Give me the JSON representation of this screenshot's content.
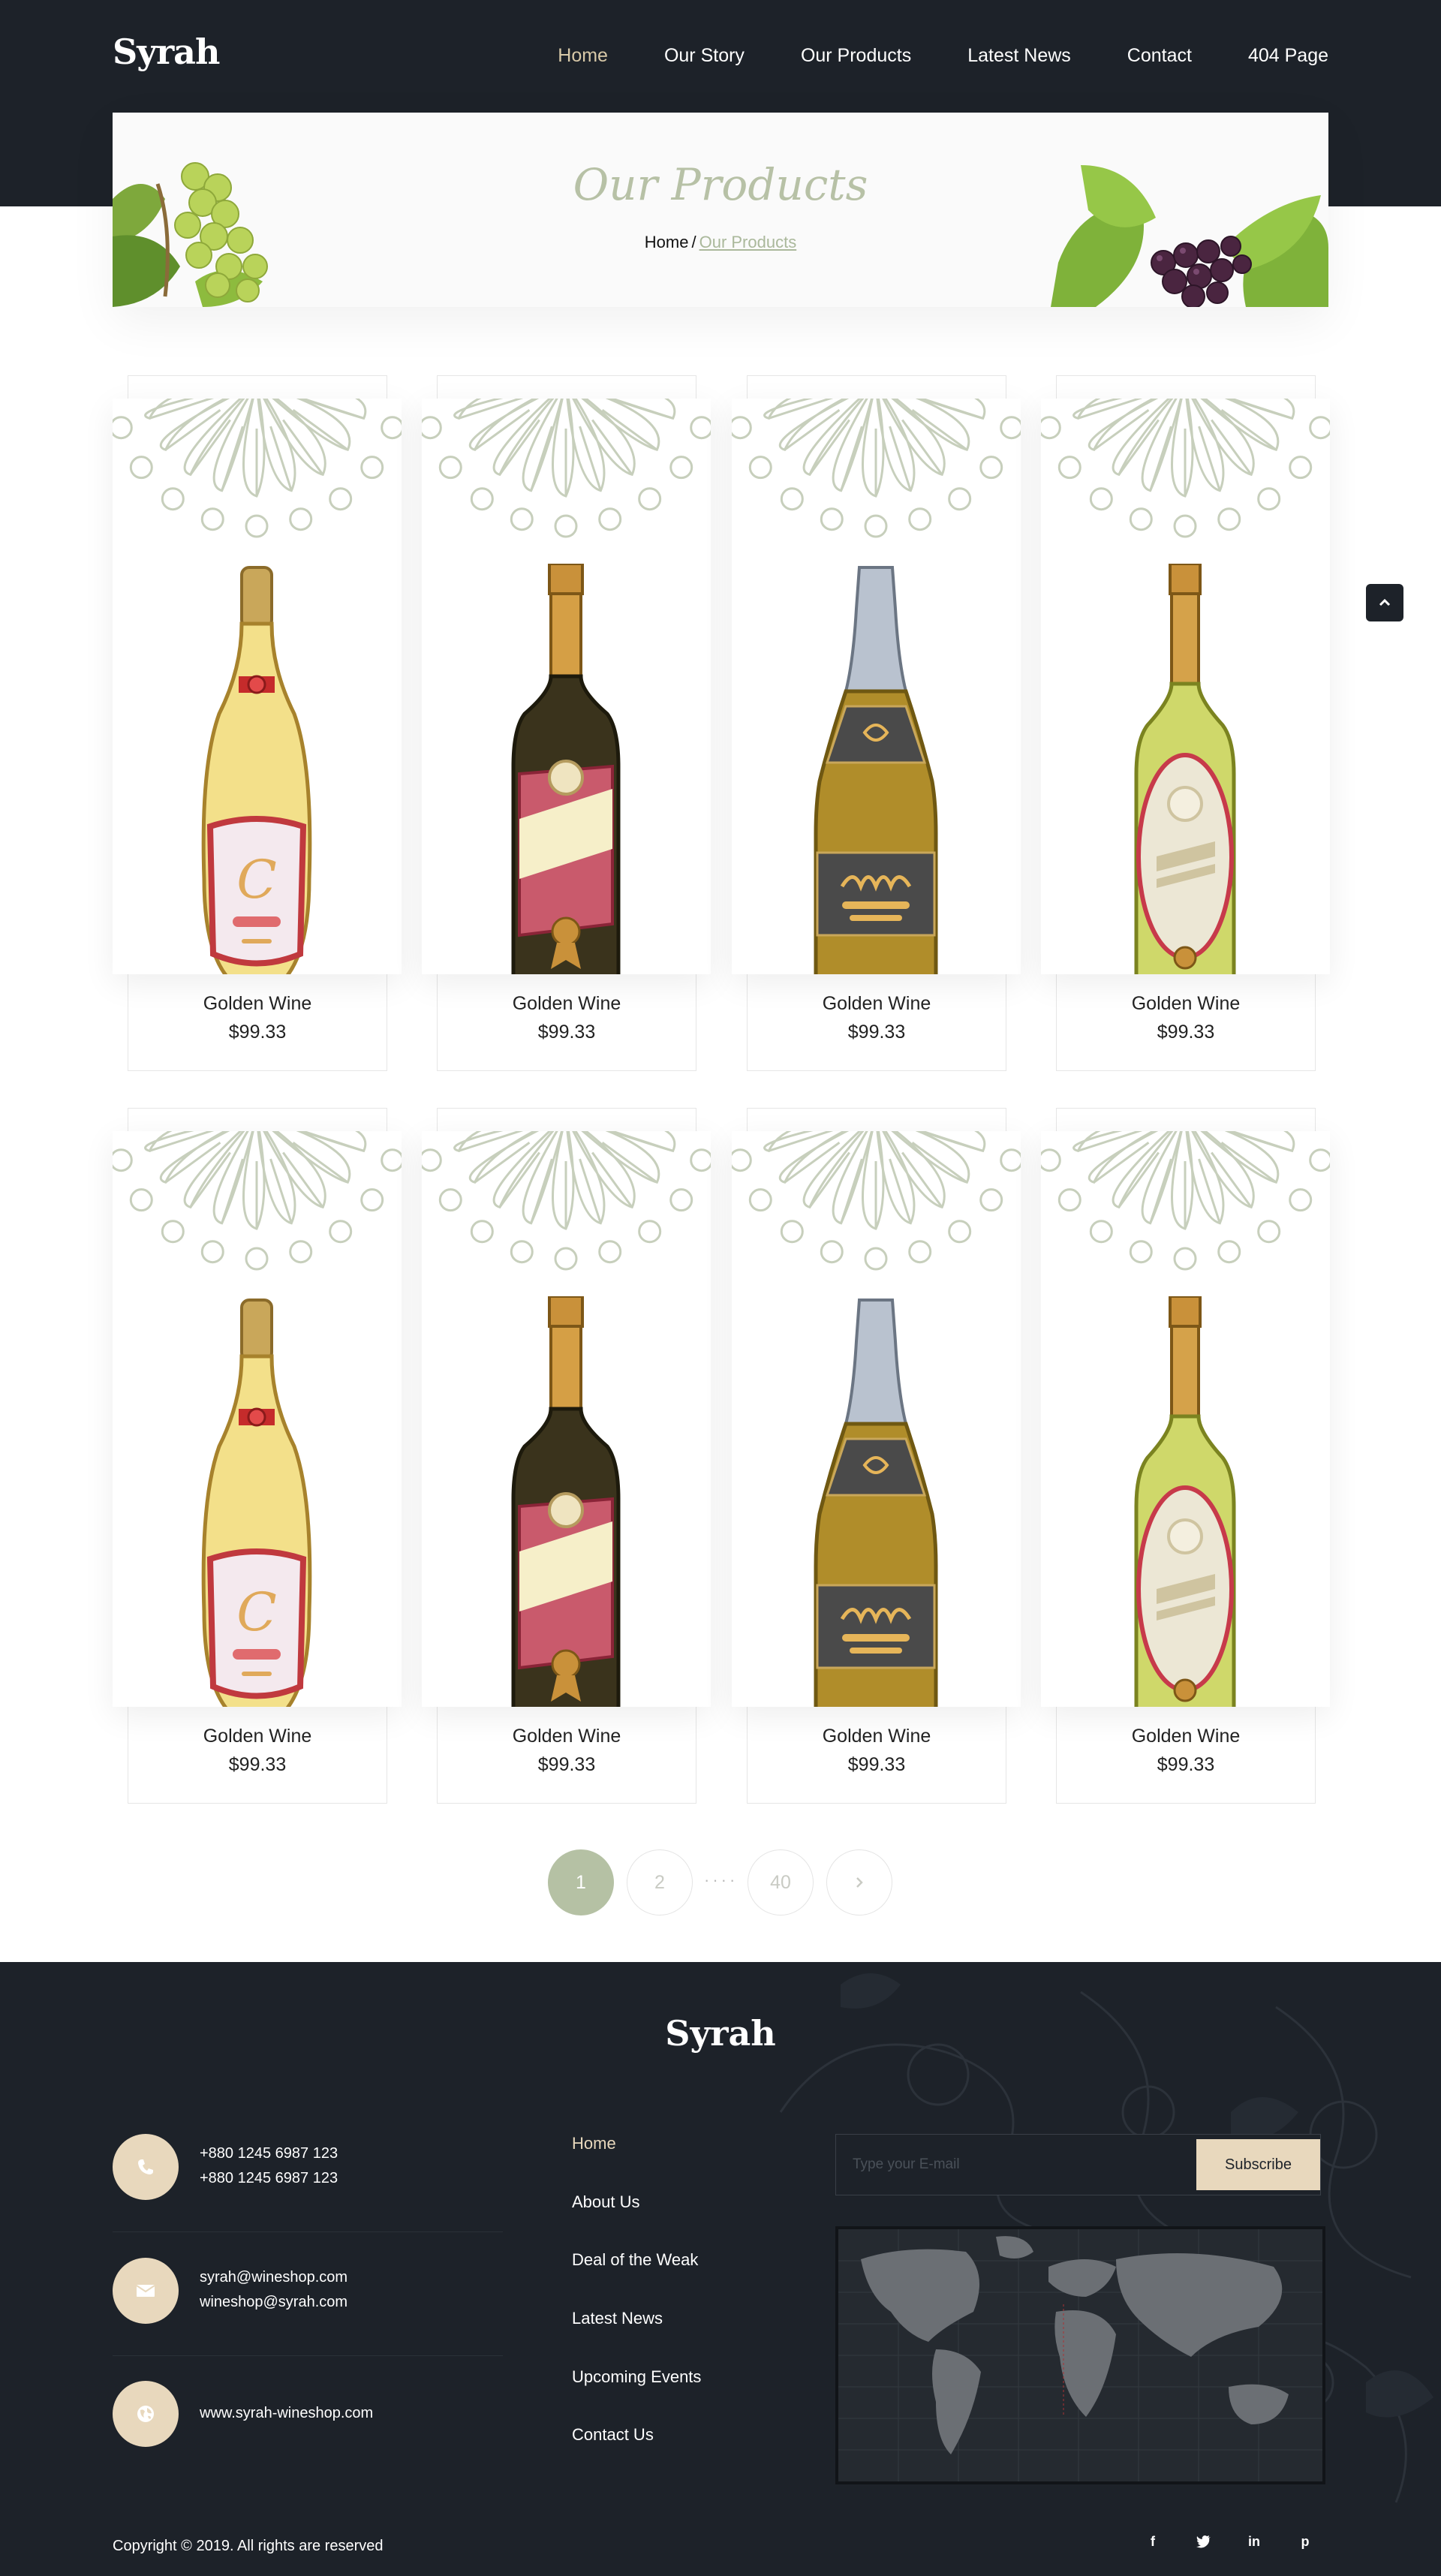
{
  "header": {
    "logo": "Syrah",
    "nav": [
      {
        "label": "Home",
        "active": true
      },
      {
        "label": "Our Story"
      },
      {
        "label": "Our Products"
      },
      {
        "label": "Latest News"
      },
      {
        "label": "Contact"
      },
      {
        "label": "404 Page"
      }
    ]
  },
  "banner": {
    "title": "Our Products",
    "breadcrumb": {
      "home": "Home",
      "separator": "/",
      "current": "Our Products"
    }
  },
  "products": [
    {
      "name": "Golden Wine",
      "price": "$99.33",
      "bottle": "champagne-gold"
    },
    {
      "name": "Golden Wine",
      "price": "$99.33",
      "bottle": "dark-red-label"
    },
    {
      "name": "Golden Wine",
      "price": "$99.33",
      "bottle": "sparkling-silver"
    },
    {
      "name": "Golden Wine",
      "price": "$99.33",
      "bottle": "white-green"
    },
    {
      "name": "Golden Wine",
      "price": "$99.33",
      "bottle": "champagne-gold"
    },
    {
      "name": "Golden Wine",
      "price": "$99.33",
      "bottle": "dark-red-label"
    },
    {
      "name": "Golden Wine",
      "price": "$99.33",
      "bottle": "sparkling-silver"
    },
    {
      "name": "Golden Wine",
      "price": "$99.33",
      "bottle": "white-green"
    }
  ],
  "pagination": {
    "pages": [
      "1",
      "2",
      "40"
    ],
    "current": "1",
    "ellipsis": "····",
    "next_icon": "chevron-right-icon"
  },
  "scroll_top_icon": "chevron-up-icon",
  "footer": {
    "logo": "Syrah",
    "contacts": [
      {
        "icon": "phone-icon",
        "lines": [
          "+880 1245 6987 123",
          "+880 1245 6987 123"
        ]
      },
      {
        "icon": "envelope-icon",
        "lines": [
          "syrah@wineshop.com",
          "wineshop@syrah.com"
        ]
      },
      {
        "icon": "globe-icon",
        "lines": [
          "www.syrah-wineshop.com"
        ]
      }
    ],
    "links": [
      {
        "label": "Home",
        "active": true
      },
      {
        "label": "About Us"
      },
      {
        "label": "Deal of the Weak"
      },
      {
        "label": "Latest News"
      },
      {
        "label": "Upcoming Events"
      },
      {
        "label": "Contact Us"
      }
    ],
    "subscribe": {
      "placeholder": "Type your E-mail",
      "button": "Subscribe"
    },
    "copyright": "Copyright © 2019. All rights are reserved",
    "social": [
      {
        "icon": "facebook-icon",
        "glyph": "f"
      },
      {
        "icon": "twitter-icon",
        "glyph": "t"
      },
      {
        "icon": "linkedin-icon",
        "glyph": "in"
      },
      {
        "icon": "pinterest-icon",
        "glyph": "p"
      }
    ]
  },
  "colors": {
    "dark": "#1d2229",
    "accent_sand": "#e8d8bd",
    "accent_sage": "#b5c1a4",
    "active_nav": "#d8c9a8"
  }
}
